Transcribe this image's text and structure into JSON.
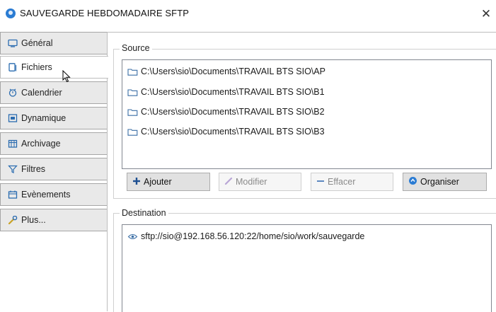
{
  "window": {
    "title": "SAUVEGARDE HEBDOMADAIRE SFTP",
    "close_glyph": "✕"
  },
  "tabs": [
    {
      "label": "Général",
      "icon": "general-icon",
      "active": false
    },
    {
      "label": "Fichiers",
      "icon": "files-icon",
      "active": true
    },
    {
      "label": "Calendrier",
      "icon": "calendar-icon",
      "active": false
    },
    {
      "label": "Dynamique",
      "icon": "dynamic-icon",
      "active": false
    },
    {
      "label": "Archivage",
      "icon": "archive-icon",
      "active": false
    },
    {
      "label": "Filtres",
      "icon": "filter-icon",
      "active": false
    },
    {
      "label": "Evènements",
      "icon": "events-icon",
      "active": false
    },
    {
      "label": "Plus...",
      "icon": "wrench-icon",
      "active": false
    }
  ],
  "source": {
    "label": "Source",
    "items": [
      "C:\\Users\\sio\\Documents\\TRAVAIL BTS SIO\\AP",
      "C:\\Users\\sio\\Documents\\TRAVAIL BTS SIO\\B1",
      "C:\\Users\\sio\\Documents\\TRAVAIL BTS SIO\\B2",
      "C:\\Users\\sio\\Documents\\TRAVAIL BTS SIO\\B3"
    ]
  },
  "buttons": {
    "add": "Ajouter",
    "modify": "Modifier",
    "delete": "Effacer",
    "organize": "Organiser"
  },
  "destination": {
    "label": "Destination",
    "items": [
      "sftp://sio@192.168.56.120:22/home/sio/work/sauvegarde"
    ]
  },
  "colors": {
    "accent": "#2b7cd3",
    "folder": "#3a6ea5"
  }
}
